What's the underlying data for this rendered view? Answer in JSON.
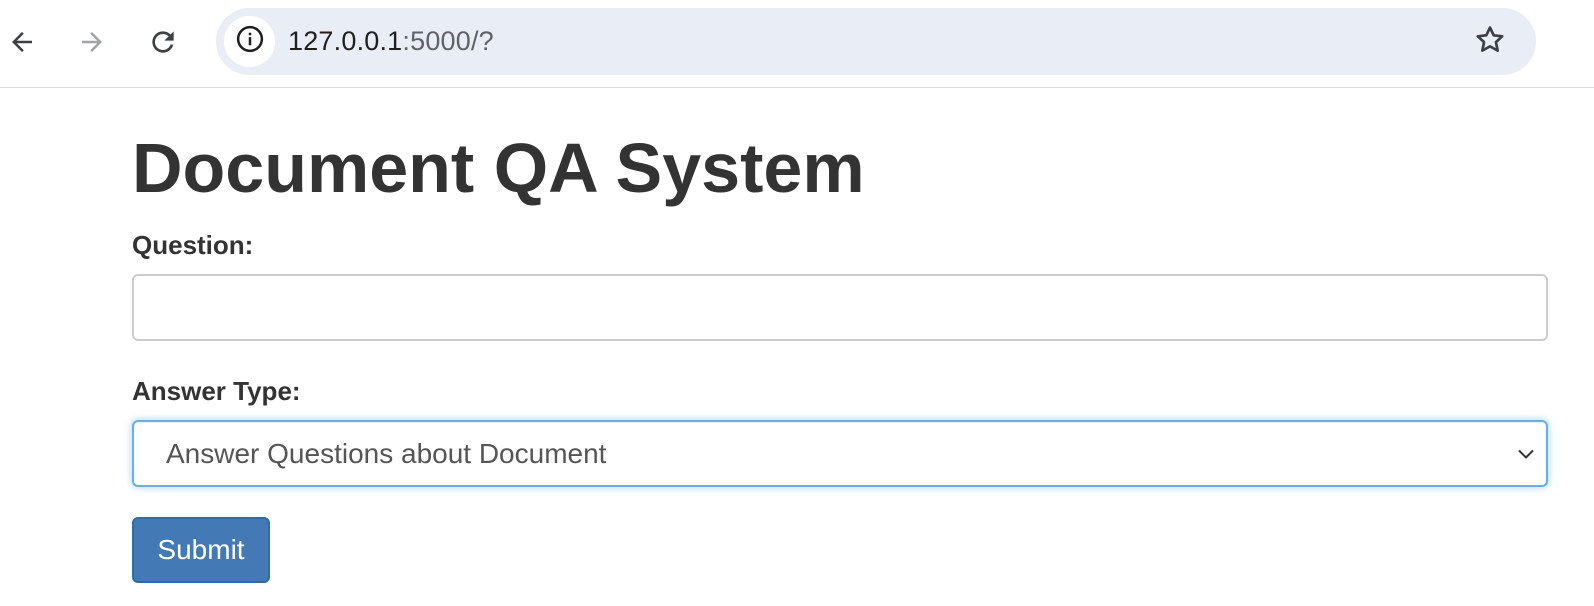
{
  "browser": {
    "url_host": "127.0.0.1",
    "url_rest": ":5000/?",
    "icons": {
      "back": "arrow-left-icon",
      "forward": "arrow-right-icon",
      "reload": "reload-icon",
      "site_info": "info-icon",
      "bookmark": "star-icon"
    }
  },
  "page": {
    "title": "Document QA System",
    "question_label": "Question:",
    "question_value": "",
    "answer_type_label": "Answer Type:",
    "answer_type_selected": "Answer Questions about Document",
    "submit_label": "Submit"
  },
  "colors": {
    "primary_button": "#437ab5",
    "focus_border": "#66afe9",
    "text": "#333333",
    "omnibox_bg": "#e9eef6"
  }
}
